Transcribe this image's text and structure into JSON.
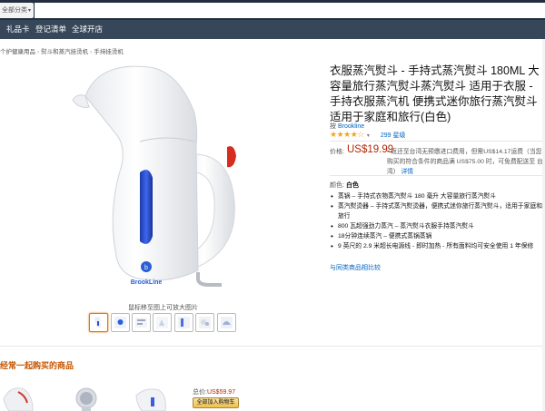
{
  "header": {
    "category_select": "全部分类",
    "nav_items": [
      "礼品卡",
      "登记清单",
      "全球开店"
    ]
  },
  "breadcrumb": [
    "个护健康用品",
    "熨斗和蒸汽挂烫机",
    "手持挂烫机"
  ],
  "product": {
    "image_brand_text": "BrookLine",
    "image_hint": "鼠标移至图上可放大图片",
    "thumbnail_count": 7,
    "title": "衣服蒸汽熨斗 - 手持式蒸汽熨斗 180ML 大容量旅行蒸汽熨斗蒸汽熨斗 适用于衣服 - 手持衣服蒸汽机 便携式迷你旅行蒸汽熨斗 适用于家庭和旅行(白色)",
    "brand_prefix": "按",
    "brand": "Brookline",
    "rating_out_of_5": 4.5,
    "rating_stars": "★★★★☆",
    "rating_count": "299 星级",
    "price_label": "价格:",
    "price": "US$19.99",
    "price_note_1": "• 返还至台湾无预缴进口费用，但需US$14.17运费（当您购买的符合条件的商品满 US$75.00 时，可免费配送至 台湾）",
    "price_note_detail": "详情",
    "color_label": "颜色:",
    "color_value": "白色",
    "bullets": [
      "蒸锅 – 手持式衣物蒸汽熨斗 180 毫升 大容量旅行蒸汽熨斗",
      "蒸汽熨烫器 – 手持式蒸汽熨烫器，便携式迷你旅行蒸汽熨斗，适用于家庭和旅行",
      "800 瓦超强劲力蒸汽 – 蒸汽熨斗衣服手持蒸汽熨斗",
      "18分钟连续蒸汽 – 便携式蒸锅蒸锅",
      "9 英尺的 2.9 米超长电源线 - 即时加热 - 所有面料均可安全使用 1 年保修"
    ],
    "compare_link": "与同类商品相比较"
  },
  "frequently_bought": {
    "heading": "经常一起购买的商品",
    "total_label": "总价:",
    "total_value": "US$59.97",
    "add_all_button": "全部加入购物车"
  },
  "colors": {
    "header_dark": "#232f3e",
    "nav_bar": "#37475a",
    "price_red": "#b12704",
    "link_blue": "#0066c0",
    "heading_orange": "#c45500",
    "star_gold": "#f4a41c",
    "steamer_blue": "#2a4fd6"
  }
}
